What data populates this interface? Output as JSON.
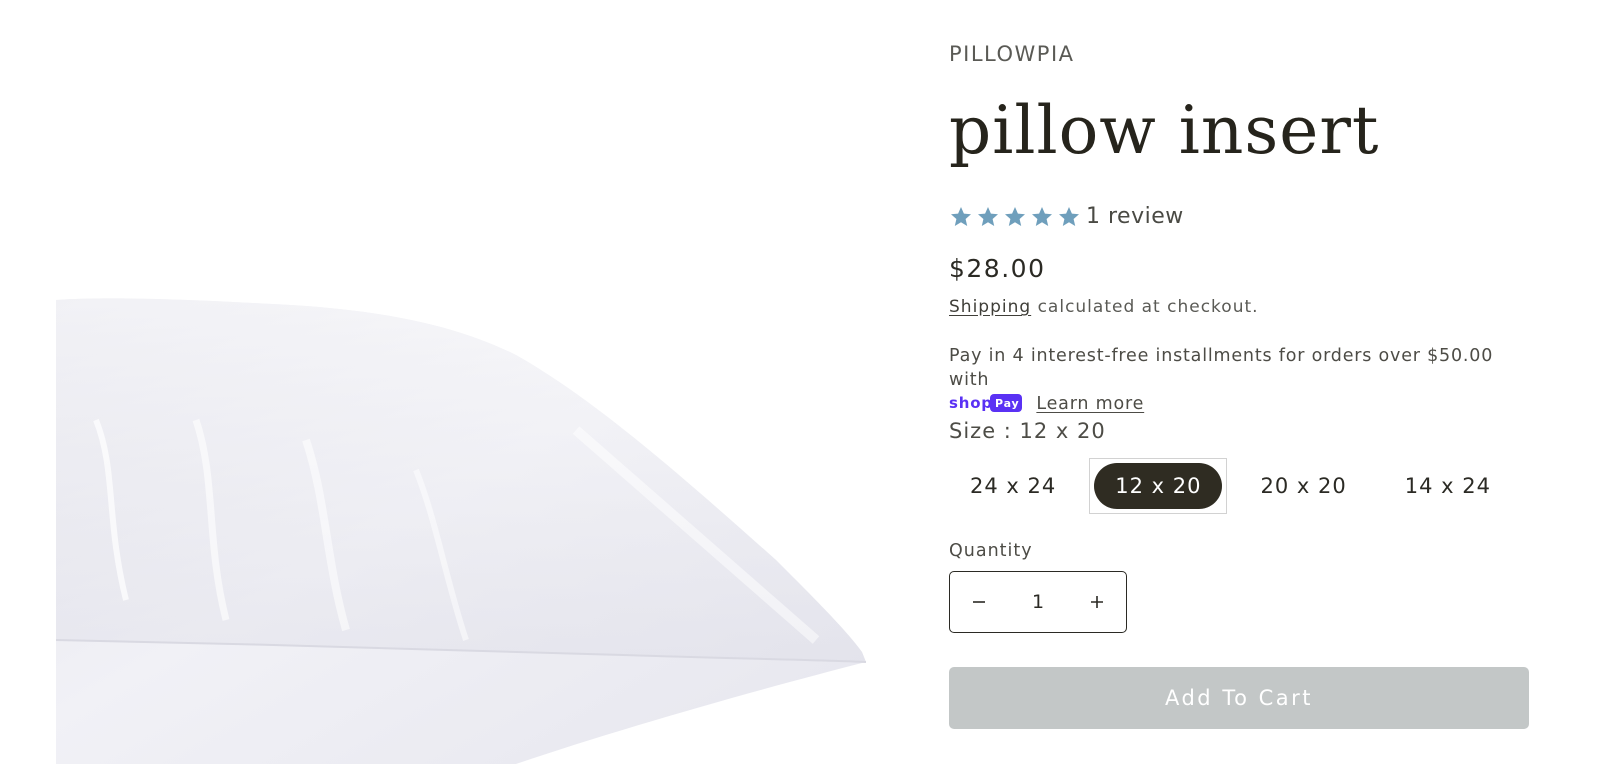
{
  "product": {
    "vendor": "PILLOWPIA",
    "title": "pillow insert",
    "image_alt": "white pillow insert",
    "rating": {
      "stars": 5,
      "max_stars": 5,
      "star_color": "#6f9fbc",
      "review_text": "1 review"
    },
    "price": "$28.00",
    "shipping": {
      "link_label": "Shipping",
      "text": " calculated at checkout."
    },
    "installments": {
      "text": "Pay in 4 interest-free installments for orders over $50.00 with",
      "provider_icon": "shop-pay-logo",
      "provider_color": "#5a31f4",
      "learn_more": "Learn more"
    },
    "size": {
      "label": "Size : 12 x 20",
      "options": [
        "24 x 24",
        "12 x 20",
        "20 x 20",
        "14 x 24"
      ],
      "selected": "12 x 20"
    },
    "quantity": {
      "label": "Quantity",
      "value": "1",
      "decrease_icon": "minus-icon",
      "increase_icon": "plus-icon"
    },
    "add_to_cart": {
      "label": "Add To Cart",
      "background": "#c3c7c7"
    }
  }
}
